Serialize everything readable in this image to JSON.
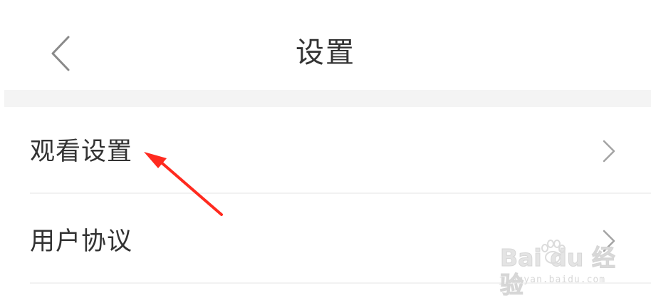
{
  "header": {
    "title": "设置",
    "back_icon": "chevron-left-icon"
  },
  "settings": {
    "items": [
      {
        "label": "观看设置",
        "icon": "chevron-right-icon"
      },
      {
        "label": "用户协议",
        "icon": "chevron-right-icon"
      }
    ]
  },
  "annotation": {
    "arrow_color": "#ff2a1f"
  },
  "watermark": {
    "logo": "Bai  du 经验",
    "site": "jingyan.baidu.com"
  },
  "colors": {
    "text_primary": "#333333",
    "icon_gray": "#9a9a9a",
    "separator": "#f4f4f4",
    "background": "#ffffff"
  }
}
